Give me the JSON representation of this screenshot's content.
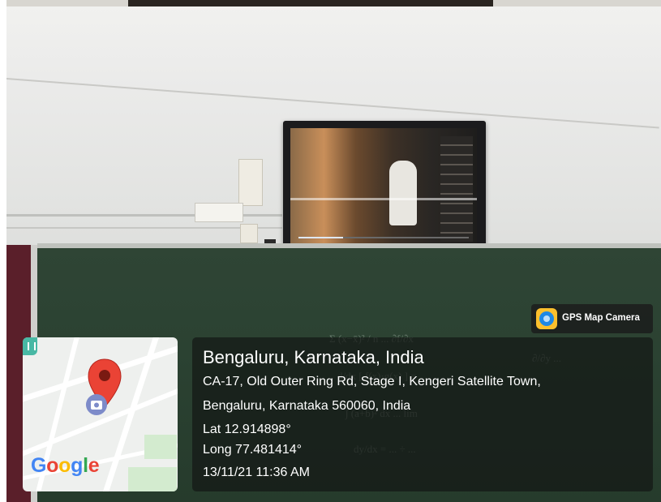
{
  "overlay": {
    "badge": {
      "app_name": "GPS Map Camera",
      "icon": "gps-map-camera-app-icon"
    },
    "map": {
      "brand": "Google",
      "pin_icon": "map-pin-icon",
      "photo_icon": "google-photos-icon",
      "tag_icon": "map-tag-icon"
    },
    "location": {
      "title": "Bengaluru, Karnataka, India",
      "address_line1": "CA-17, Old Outer Ring Rd, Stage I, Kengeri Satellite Town,",
      "address_line2": "Bengaluru, Karnataka 560060, India",
      "latitude": "Lat 12.914898°",
      "longitude": "Long 77.481414°",
      "datetime": "13/11/21 11:36 AM"
    }
  },
  "colors": {
    "google_blue": "#4285F4",
    "google_red": "#EA4335",
    "google_yellow": "#FBBC05",
    "google_green": "#34A853",
    "pin_red": "#EA4335",
    "overlay_bg": "#141816",
    "chalkboard": "#2b4232"
  }
}
